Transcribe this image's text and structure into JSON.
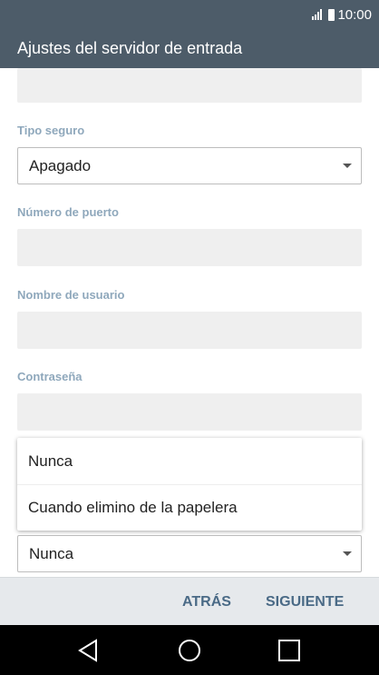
{
  "status_bar": {
    "time": "10:00"
  },
  "app_bar": {
    "title": "Ajustes del servidor de entrada"
  },
  "form": {
    "tipo_seguro": {
      "label": "Tipo seguro",
      "value": "Apagado"
    },
    "numero_de_puerto": {
      "label": "Número de puerto",
      "value": ""
    },
    "nombre_de_usuario": {
      "label": "Nombre de usuario",
      "value": ""
    },
    "contrasena": {
      "label": "Contraseña",
      "value": ""
    },
    "delete_policy": {
      "value": "Nunca"
    }
  },
  "popup_menu": {
    "items": [
      {
        "label": "Nunca"
      },
      {
        "label": "Cuando elimino de la papelera"
      }
    ]
  },
  "bottom_bar": {
    "back_label": "ATRÁS",
    "next_label": "SIGUIENTE"
  },
  "colors": {
    "app_bar": "#4d5c69",
    "label": "#8fa8bc",
    "action": "#4a6a86"
  },
  "icons": {
    "signal": "signal-icon",
    "battery": "battery-icon",
    "back": "back-triangle-icon",
    "home": "home-circle-icon",
    "recents": "recents-square-icon"
  }
}
